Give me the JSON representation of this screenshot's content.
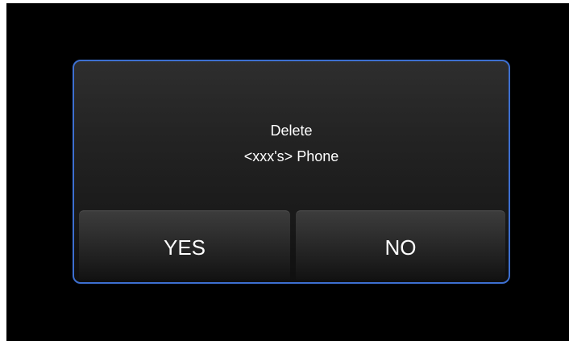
{
  "dialog": {
    "line1": "Delete",
    "line2": "<xxx's> Phone",
    "yes_label": "YES",
    "no_label": "NO"
  },
  "colors": {
    "border": "#3d6fd0",
    "background": "#000000",
    "text": "#ffffff"
  }
}
